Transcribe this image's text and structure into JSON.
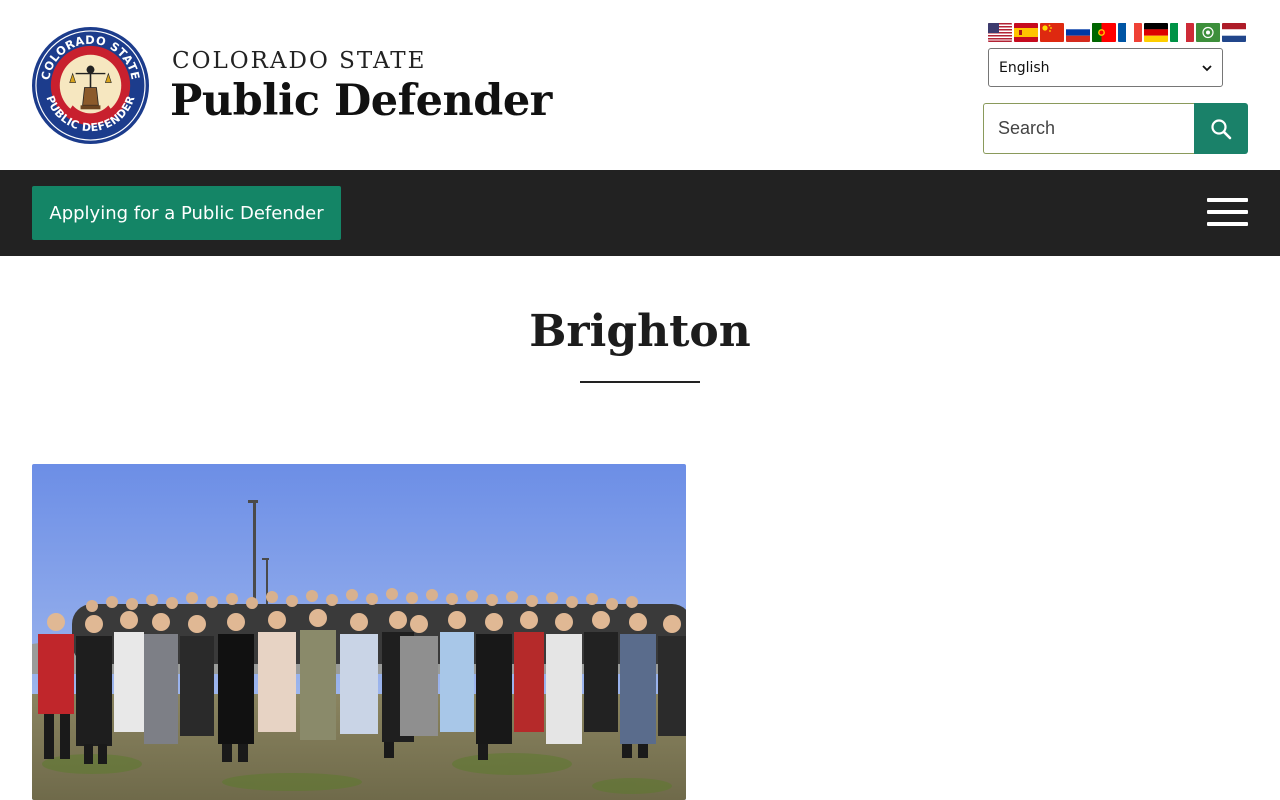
{
  "header": {
    "brand_top": "COLORADO STATE",
    "brand_main": "Public Defender",
    "logo": {
      "ring_text_top": "COLORADO STATE",
      "ring_text_bottom": "PUBLIC DEFENDER",
      "inner_text": "THAT JUSTICE ESCAPE NONE"
    },
    "languages": [
      {
        "icon": "flag-us-icon",
        "name": "English"
      },
      {
        "icon": "flag-es-icon",
        "name": "Spanish"
      },
      {
        "icon": "flag-cn-icon",
        "name": "Chinese"
      },
      {
        "icon": "flag-ru-icon",
        "name": "Russian"
      },
      {
        "icon": "flag-pt-icon",
        "name": "Portuguese"
      },
      {
        "icon": "flag-fr-icon",
        "name": "French"
      },
      {
        "icon": "flag-de-icon",
        "name": "German"
      },
      {
        "icon": "flag-it-icon",
        "name": "Italian"
      },
      {
        "icon": "flag-ar-icon",
        "name": "Arabic"
      },
      {
        "icon": "flag-nl-icon",
        "name": "Dutch"
      }
    ],
    "language_select": {
      "selected": "English"
    },
    "search": {
      "placeholder": "Search",
      "button_icon": "search-icon"
    }
  },
  "navbar": {
    "apply_label": "Applying for a Public Defender",
    "menu_icon": "hamburger-menu-icon"
  },
  "main": {
    "title": "Brighton",
    "photo_icon": "group-photo"
  },
  "colors": {
    "accent": "#148566",
    "navbar_bg": "#222222",
    "text": "#1c1c1c"
  }
}
